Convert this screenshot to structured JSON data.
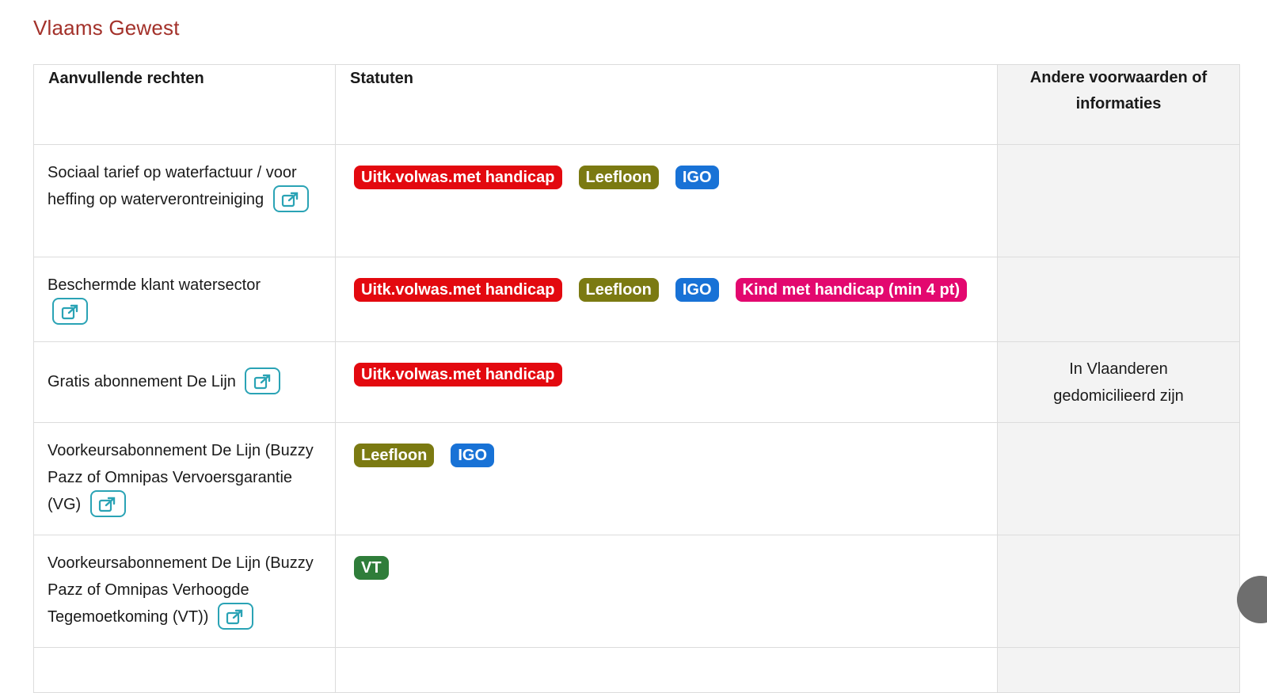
{
  "region": {
    "title": "Vlaams Gewest"
  },
  "table": {
    "headers": {
      "rights": "Aanvullende rechten",
      "statutes": "Statuten",
      "other": "Andere voorwaarden of informaties"
    },
    "rows": [
      {
        "right": "Sociaal tarief op waterfactuur / voor heffing op waterverontreiniging",
        "badges": [
          {
            "label": "Uitk.volwas.met handicap",
            "color": "#e3090f"
          },
          {
            "label": "Leefloon",
            "color": "#7b7a12"
          },
          {
            "label": "IGO",
            "color": "#1872d6"
          }
        ],
        "other": ""
      },
      {
        "right": "Beschermde klant watersector",
        "badges": [
          {
            "label": "Uitk.volwas.met handicap",
            "color": "#e3090f"
          },
          {
            "label": "Leefloon",
            "color": "#7b7a12"
          },
          {
            "label": "IGO",
            "color": "#1872d6"
          },
          {
            "label": "Kind met handicap (min 4 pt)",
            "color": "#e3086f"
          }
        ],
        "other": ""
      },
      {
        "right": "Gratis abonnement De Lijn",
        "badges": [
          {
            "label": "Uitk.volwas.met handicap",
            "color": "#e3090f"
          }
        ],
        "other": "In Vlaanderen gedomicilieerd zijn"
      },
      {
        "right": "Voorkeursabonnement De Lijn (Buzzy Pazz of Omnipas Vervoersgarantie (VG)",
        "badges": [
          {
            "label": "Leefloon",
            "color": "#7b7a12"
          },
          {
            "label": "IGO",
            "color": "#1872d6"
          }
        ],
        "other": ""
      },
      {
        "right": "Voorkeursabonnement De Lijn (Buzzy Pazz of Omnipas Verhoogde Tegemoetkoming (VT))",
        "badges": [
          {
            "label": "VT",
            "color": "#2f7d3a"
          }
        ],
        "other": ""
      }
    ]
  },
  "icons": {
    "external_link": "external-link-icon"
  },
  "colors": {
    "title": "#a3312a",
    "link_border": "#2aa3b5",
    "info_bg": "#f3f3f3"
  }
}
